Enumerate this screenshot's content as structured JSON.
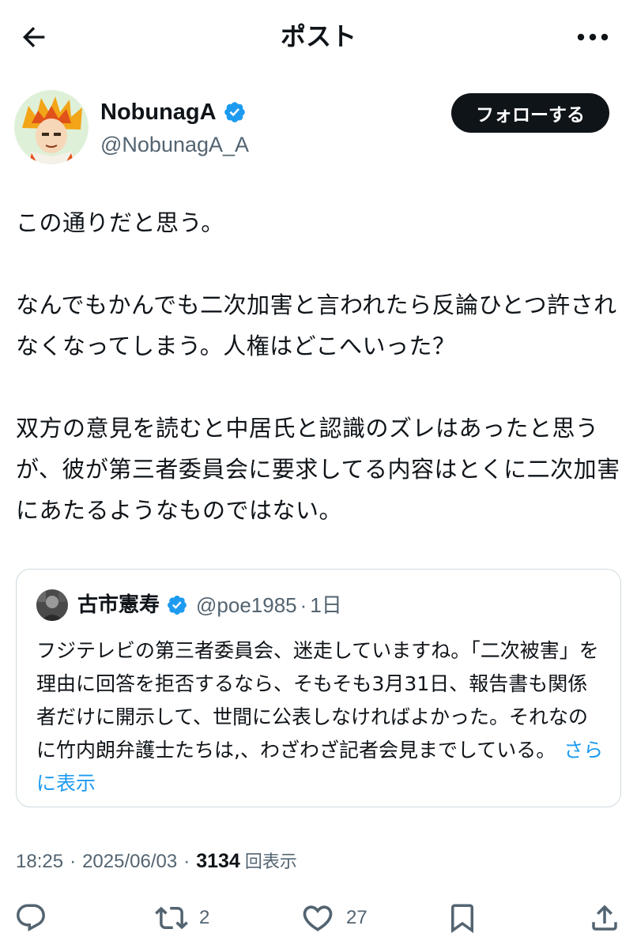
{
  "header": {
    "title": "ポスト"
  },
  "author": {
    "display_name": "NobunagA",
    "handle": "@NobunagA_A",
    "verified": true,
    "follow_label": "フォローする"
  },
  "post": {
    "paragraphs": [
      "この通りだと思う。",
      "なんでもかんでも二次加害と言われたら反論ひとつ許されなくなってしまう。人権はどこへいった？",
      "双方の意見を読むと中居氏と認識のズレはあったと思うが、彼が第三者委員会に要求してる内容はとくに二次加害にあたるようなものではない。"
    ]
  },
  "quoted_post": {
    "display_name": "古市憲寿",
    "handle": "@poe1985",
    "separator": "·",
    "time": "1日",
    "text": "フジテレビの第三者委員会、迷走していますね。「二次被害」を理由に回答を拒否するなら、そもそも3月31日、報告書も関係者だけに開示して、世間に公表しなければよかった。それなのに竹内朗弁護士たちは,、わざわざ記者会見までしている。",
    "show_more": "さらに表示"
  },
  "meta": {
    "time": "18:25",
    "date": "2025/06/03",
    "separator": "·",
    "views": "3134",
    "views_label": "回表示"
  },
  "actions": {
    "reply_count": "",
    "repost_count": "2",
    "like_count": "27"
  },
  "colors": {
    "text": "#0f1419",
    "secondary": "#536471",
    "verified": "#1d9bf0",
    "border": "#cfd9de",
    "link": "#1d9bf0"
  },
  "icons": {
    "back": "arrow-left-icon",
    "more": "more-horizontal-icon",
    "verified": "verified-badge-icon",
    "reply": "reply-icon",
    "repost": "repost-icon",
    "like": "heart-icon",
    "bookmark": "bookmark-icon",
    "share": "share-icon"
  }
}
